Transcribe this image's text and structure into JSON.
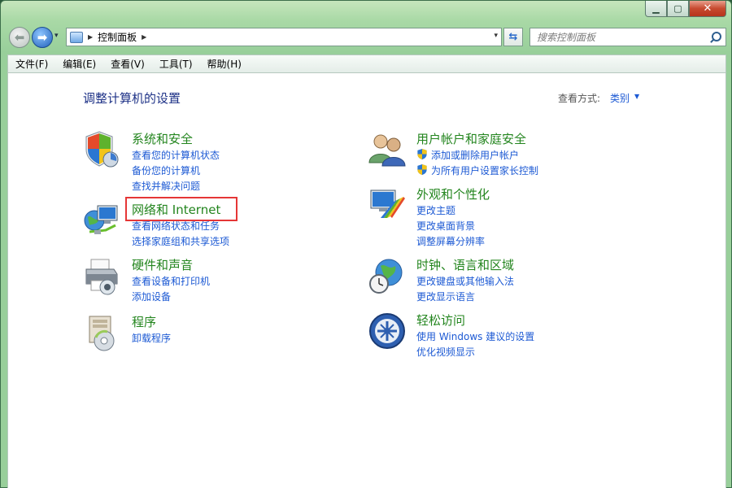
{
  "caption": {
    "minimize": "▁",
    "maximize": "▢",
    "close": "✕"
  },
  "nav": {
    "back": "⬅",
    "forward": "➡",
    "history": "▾"
  },
  "address": {
    "separator": "▶",
    "path": "控制面板",
    "end_separator": "▶",
    "dropdown": "▾"
  },
  "refresh": "⇆",
  "search": {
    "placeholder": "搜索控制面板"
  },
  "menu": [
    "文件(F)",
    "编辑(E)",
    "查看(V)",
    "工具(T)",
    "帮助(H)"
  ],
  "page_title": "调整计算机的设置",
  "view": {
    "label": "查看方式:",
    "value": "类别",
    "arrow": "▼"
  },
  "categories": [
    {
      "title": "系统和安全",
      "links": [
        "查看您的计算机状态",
        "备份您的计算机",
        "查找并解决问题"
      ]
    },
    {
      "title": "网络和 Internet",
      "links": [
        "查看网络状态和任务",
        "选择家庭组和共享选项"
      ]
    },
    {
      "title": "硬件和声音",
      "links": [
        "查看设备和打印机",
        "添加设备"
      ]
    },
    {
      "title": "程序",
      "links": [
        "卸载程序"
      ]
    },
    {
      "title": "用户帐户和家庭安全",
      "links": [
        "添加或删除用户帐户",
        "为所有用户设置家长控制"
      ]
    },
    {
      "title": "外观和个性化",
      "links": [
        "更改主题",
        "更改桌面背景",
        "调整屏幕分辨率"
      ]
    },
    {
      "title": "时钟、语言和区域",
      "links": [
        "更改键盘或其他输入法",
        "更改显示语言"
      ]
    },
    {
      "title": "轻松访问",
      "links": [
        "使用 Windows 建议的设置",
        "优化视频显示"
      ]
    }
  ],
  "colors": {
    "category_title": "#23851e",
    "link": "#1d5ad4",
    "page_title": "#1e3287",
    "highlight": "#e53636"
  }
}
